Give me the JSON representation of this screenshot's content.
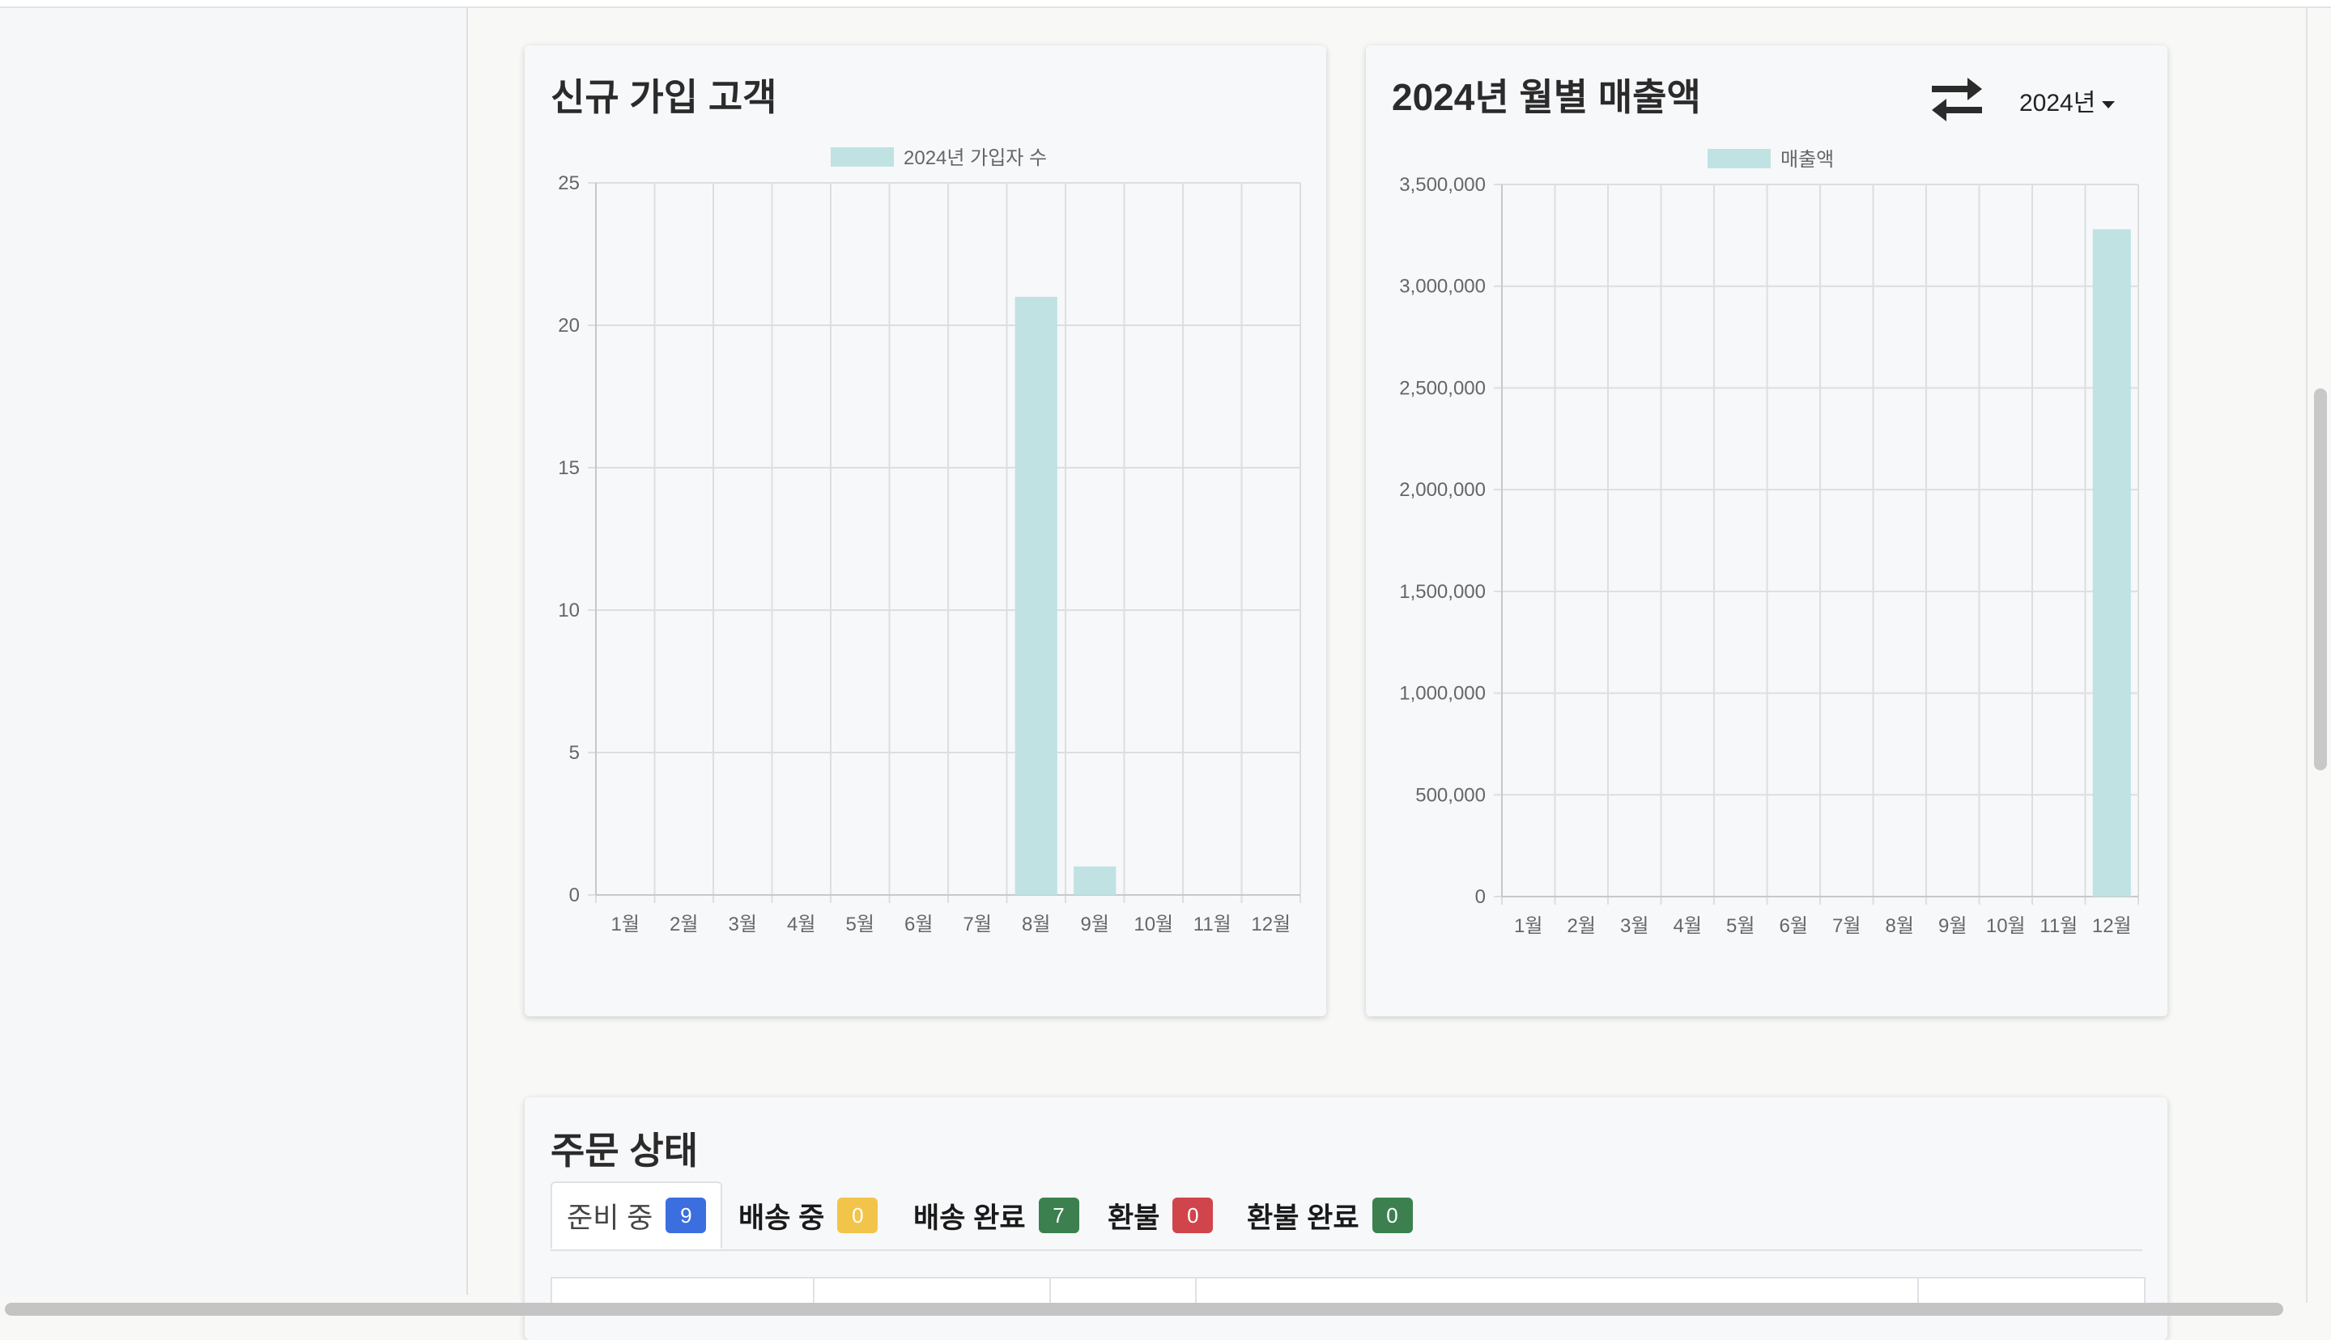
{
  "charts_section": {
    "signup_card": {
      "title": "신규 가입 고객"
    },
    "sales_card": {
      "title": "2024년 월별 매출액",
      "year_selector": "2024년",
      "swap_icon": "swap-arrows-icon"
    }
  },
  "chart_data": [
    {
      "type": "bar",
      "title": "신규 가입 고객",
      "categories": [
        "1월",
        "2월",
        "3월",
        "4월",
        "5월",
        "6월",
        "7월",
        "8월",
        "9월",
        "10월",
        "11월",
        "12월"
      ],
      "series": [
        {
          "name": "2024년 가입자 수",
          "values": [
            0,
            0,
            0,
            0,
            0,
            0,
            0,
            21,
            1,
            0,
            0,
            0
          ]
        }
      ],
      "ylim": [
        0,
        25
      ],
      "yticks": [
        "0",
        "5",
        "10",
        "15",
        "20",
        "25"
      ],
      "grid": true,
      "legend": "top-center",
      "bar_color": "#c0e2e2"
    },
    {
      "type": "bar",
      "title": "2024년 월별 매출액",
      "categories": [
        "1월",
        "2월",
        "3월",
        "4월",
        "5월",
        "6월",
        "7월",
        "8월",
        "9월",
        "10월",
        "11월",
        "12월"
      ],
      "series": [
        {
          "name": "매출액",
          "values": [
            0,
            0,
            0,
            0,
            0,
            0,
            0,
            0,
            0,
            0,
            0,
            3280000
          ]
        }
      ],
      "ylim": [
        0,
        3500000
      ],
      "yticks": [
        "0",
        "500,000",
        "1,000,000",
        "1,500,000",
        "2,000,000",
        "2,500,000",
        "3,000,000",
        "3,500,000"
      ],
      "grid": true,
      "legend": "top-center",
      "bar_color": "#c0e2e2"
    }
  ],
  "order_status": {
    "title": "주문 상태",
    "tabs": [
      {
        "label": "준비 중",
        "count": "9",
        "color": "#3b6fe0",
        "active": true
      },
      {
        "label": "배송 중",
        "count": "0",
        "color": "#f2c44a",
        "active": false
      },
      {
        "label": "배송 완료",
        "count": "7",
        "color": "#3c8050",
        "active": false
      },
      {
        "label": "환불",
        "count": "0",
        "color": "#d0454c",
        "active": false
      },
      {
        "label": "환불 완료",
        "count": "0",
        "color": "#3c8050",
        "active": false
      }
    ]
  }
}
